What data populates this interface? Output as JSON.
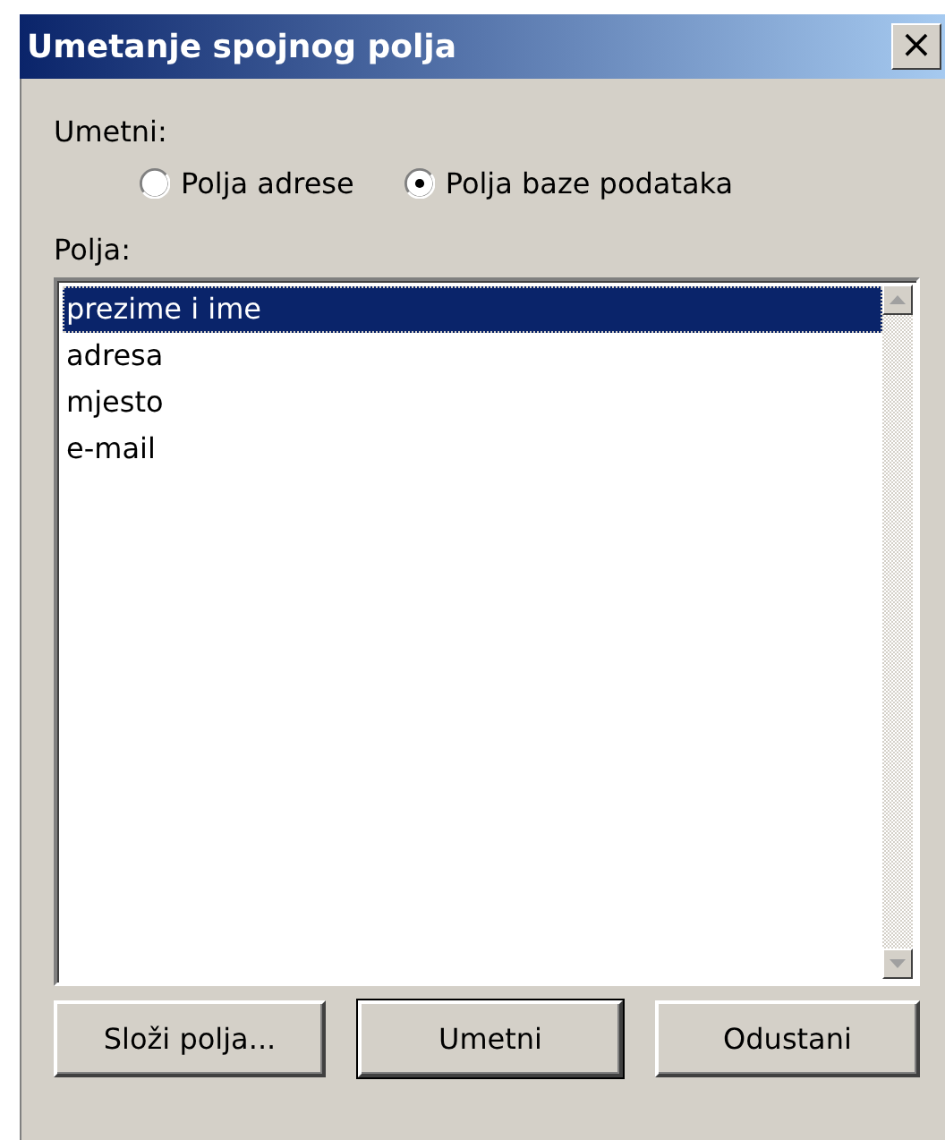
{
  "window": {
    "title": "Umetanje spojnog polja",
    "close": "×"
  },
  "insert_group": {
    "label": "Umetni:",
    "options": [
      {
        "label": "Polja adrese",
        "selected": false
      },
      {
        "label": "Polja baze podataka",
        "selected": true
      }
    ]
  },
  "fields": {
    "label": "Polja:",
    "items": [
      {
        "label": "prezime i ime",
        "selected": true
      },
      {
        "label": "adresa",
        "selected": false
      },
      {
        "label": "mjesto",
        "selected": false
      },
      {
        "label": "e-mail",
        "selected": false
      }
    ]
  },
  "buttons": [
    {
      "label": "Složi polja...",
      "default": false
    },
    {
      "label": "Umetni",
      "default": true
    },
    {
      "label": "Odustani",
      "default": false
    }
  ]
}
